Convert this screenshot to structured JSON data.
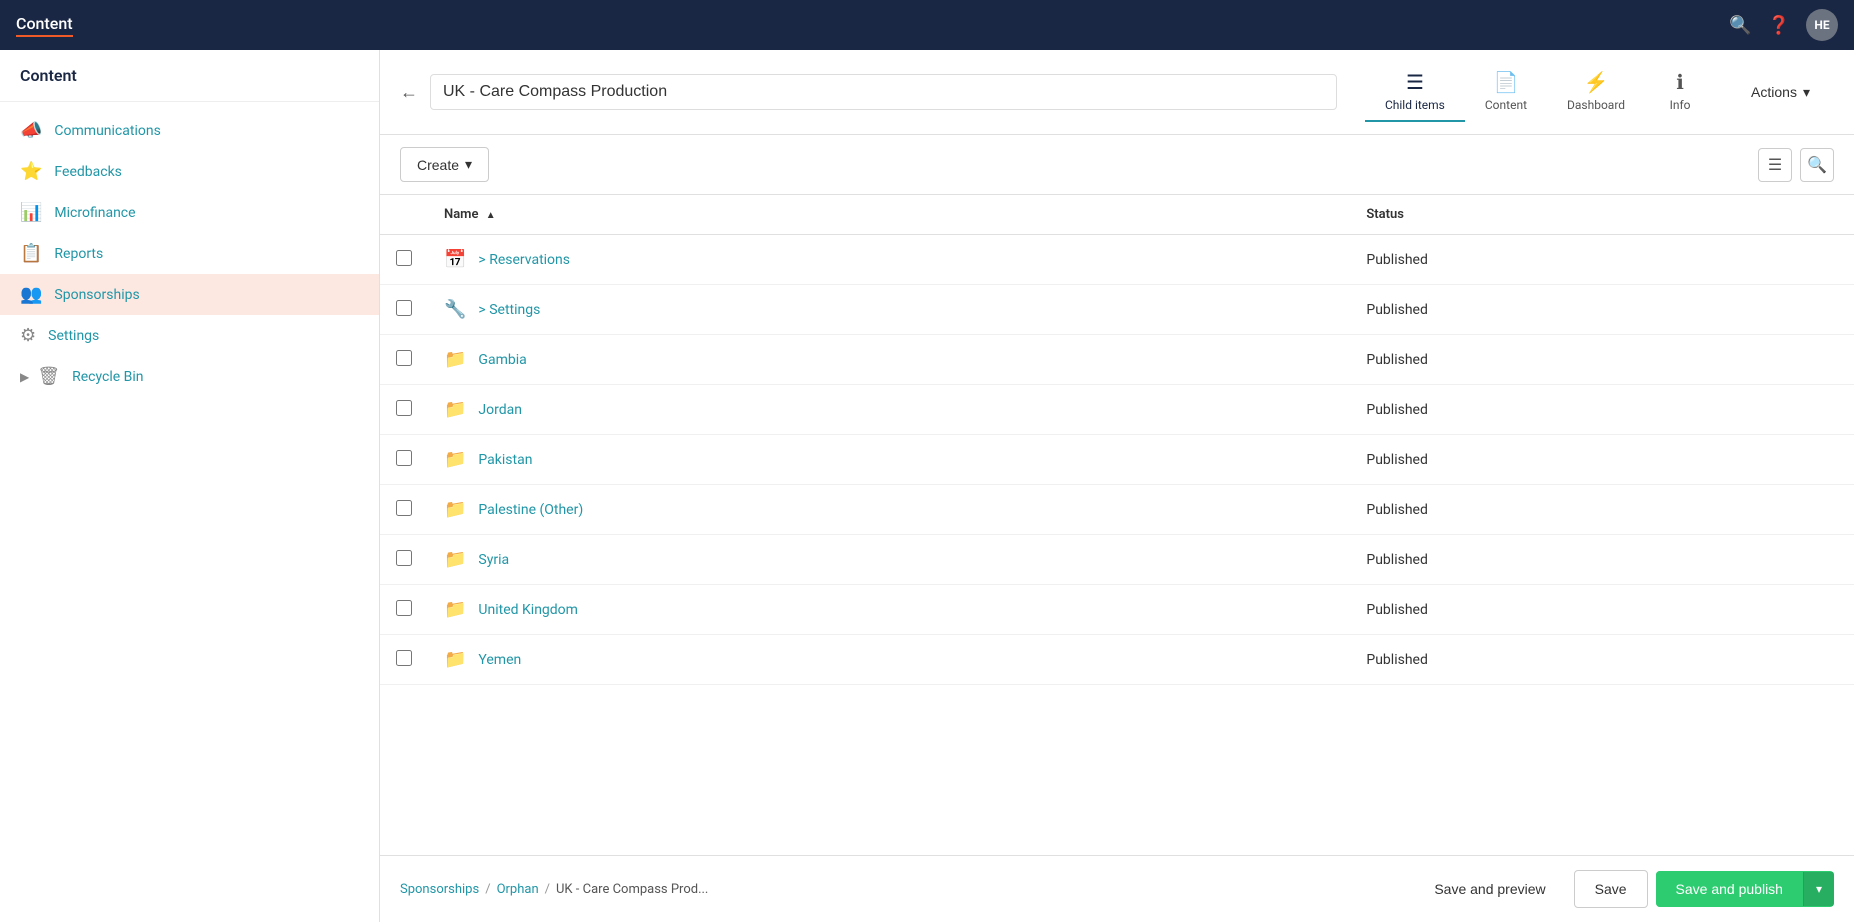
{
  "topbar": {
    "title": "Content",
    "user_initials": "HE"
  },
  "sidebar": {
    "header": "Content",
    "items": [
      {
        "id": "communications",
        "label": "Communications",
        "icon": "📣"
      },
      {
        "id": "feedbacks",
        "label": "Feedbacks",
        "icon": "⭐"
      },
      {
        "id": "microfinance",
        "label": "Microfinance",
        "icon": "📊"
      },
      {
        "id": "reports",
        "label": "Reports",
        "icon": "📋"
      },
      {
        "id": "sponsorships",
        "label": "Sponsorships",
        "icon": "👥",
        "active": true
      },
      {
        "id": "settings",
        "label": "Settings",
        "icon": "⚙"
      },
      {
        "id": "recycle-bin",
        "label": "Recycle Bin",
        "icon": "🗑",
        "expandable": true
      }
    ]
  },
  "node_editor": {
    "back_label": "←",
    "title": "UK - Care Compass Production",
    "tabs": [
      {
        "id": "child-items",
        "label": "Child items",
        "icon": "≡",
        "active": true
      },
      {
        "id": "content",
        "label": "Content",
        "icon": "📄"
      },
      {
        "id": "dashboard",
        "label": "Dashboard",
        "icon": "⚡"
      },
      {
        "id": "info",
        "label": "Info",
        "icon": "ℹ"
      }
    ],
    "actions_label": "Actions",
    "create_label": "Create"
  },
  "table": {
    "columns": [
      {
        "id": "name",
        "label": "Name",
        "sortable": true,
        "sort_dir": "asc"
      },
      {
        "id": "status",
        "label": "Status"
      }
    ],
    "rows": [
      {
        "id": 1,
        "icon": "calendar",
        "name": "> Reservations",
        "status": "Published"
      },
      {
        "id": 2,
        "icon": "wrench",
        "name": "> Settings",
        "status": "Published"
      },
      {
        "id": 3,
        "icon": "folder",
        "name": "Gambia",
        "status": "Published"
      },
      {
        "id": 4,
        "icon": "folder",
        "name": "Jordan",
        "status": "Published"
      },
      {
        "id": 5,
        "icon": "folder",
        "name": "Pakistan",
        "status": "Published"
      },
      {
        "id": 6,
        "icon": "folder",
        "name": "Palestine (Other)",
        "status": "Published"
      },
      {
        "id": 7,
        "icon": "folder",
        "name": "Syria",
        "status": "Published"
      },
      {
        "id": 8,
        "icon": "folder",
        "name": "United Kingdom",
        "status": "Published"
      },
      {
        "id": 9,
        "icon": "folder",
        "name": "Yemen",
        "status": "Published"
      }
    ]
  },
  "footer": {
    "breadcrumb": [
      {
        "label": "Sponsorships",
        "link": true
      },
      {
        "label": "/",
        "sep": true
      },
      {
        "label": "Orphan",
        "link": true
      },
      {
        "label": "/",
        "sep": true
      },
      {
        "label": "UK - Care Compass Prod...",
        "current": true
      }
    ],
    "save_preview_label": "Save and preview",
    "save_label": "Save",
    "save_publish_label": "Save and publish"
  },
  "icons": {
    "calendar": "📅",
    "wrench": "🔧",
    "folder": "📁",
    "list": "☰",
    "search": "🔍",
    "chevron_down": "▾",
    "sort_asc": "▲"
  }
}
